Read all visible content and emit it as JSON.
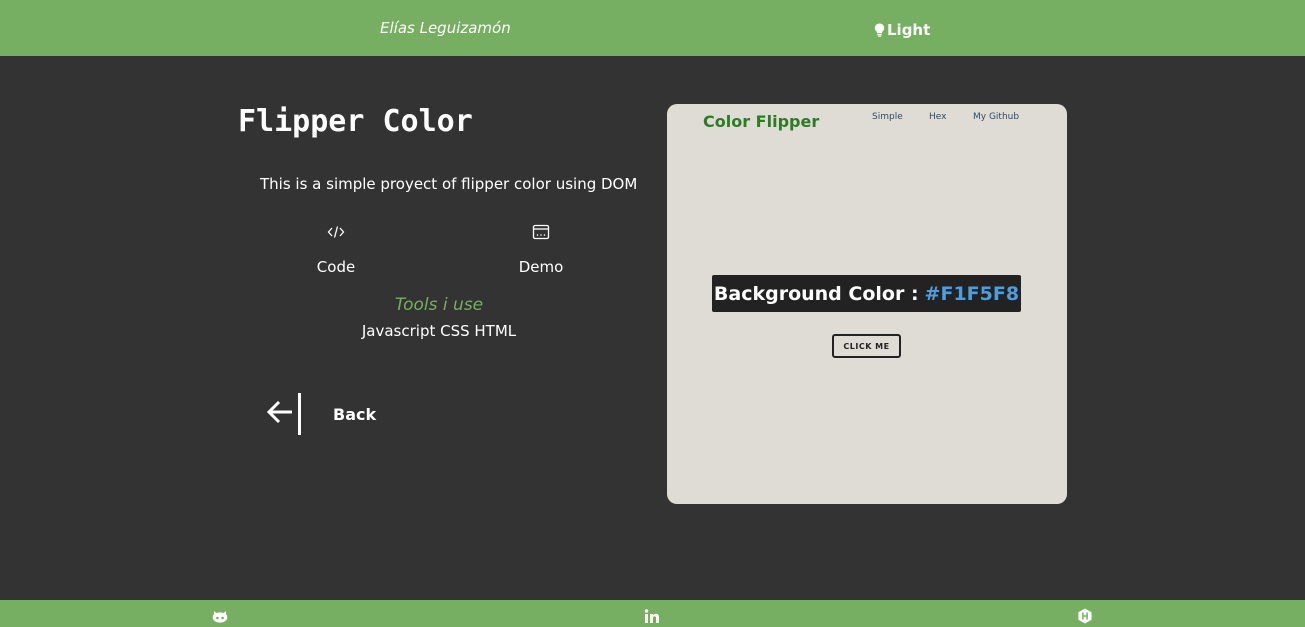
{
  "header": {
    "brand": "Elías Leguizamón",
    "theme_label": "Light",
    "theme_icon": "lightbulb-icon"
  },
  "project": {
    "title": "Flipper Color",
    "description": "This is a simple proyect of flipper color using DOM",
    "links": [
      {
        "label": "Code",
        "icon": "code-icon"
      },
      {
        "label": "Demo",
        "icon": "browser-window-icon"
      }
    ],
    "tools_title": "Tools i use",
    "tools": "Javascript CSS HTML",
    "back_label": "Back"
  },
  "preview": {
    "brand": "Color Flipper",
    "nav": [
      "Simple",
      "Hex",
      "My Github"
    ],
    "banner_label": "Background Color :",
    "banner_value": "#F1F5F8",
    "button_label": "CLICK ME",
    "background": "#dfdcd6"
  },
  "footer": {
    "icons": [
      "github-icon",
      "linkedin-icon",
      "hackerrank-icon"
    ]
  },
  "colors": {
    "accent": "#76ae62",
    "background": "#333333",
    "text": "#ffffff"
  }
}
